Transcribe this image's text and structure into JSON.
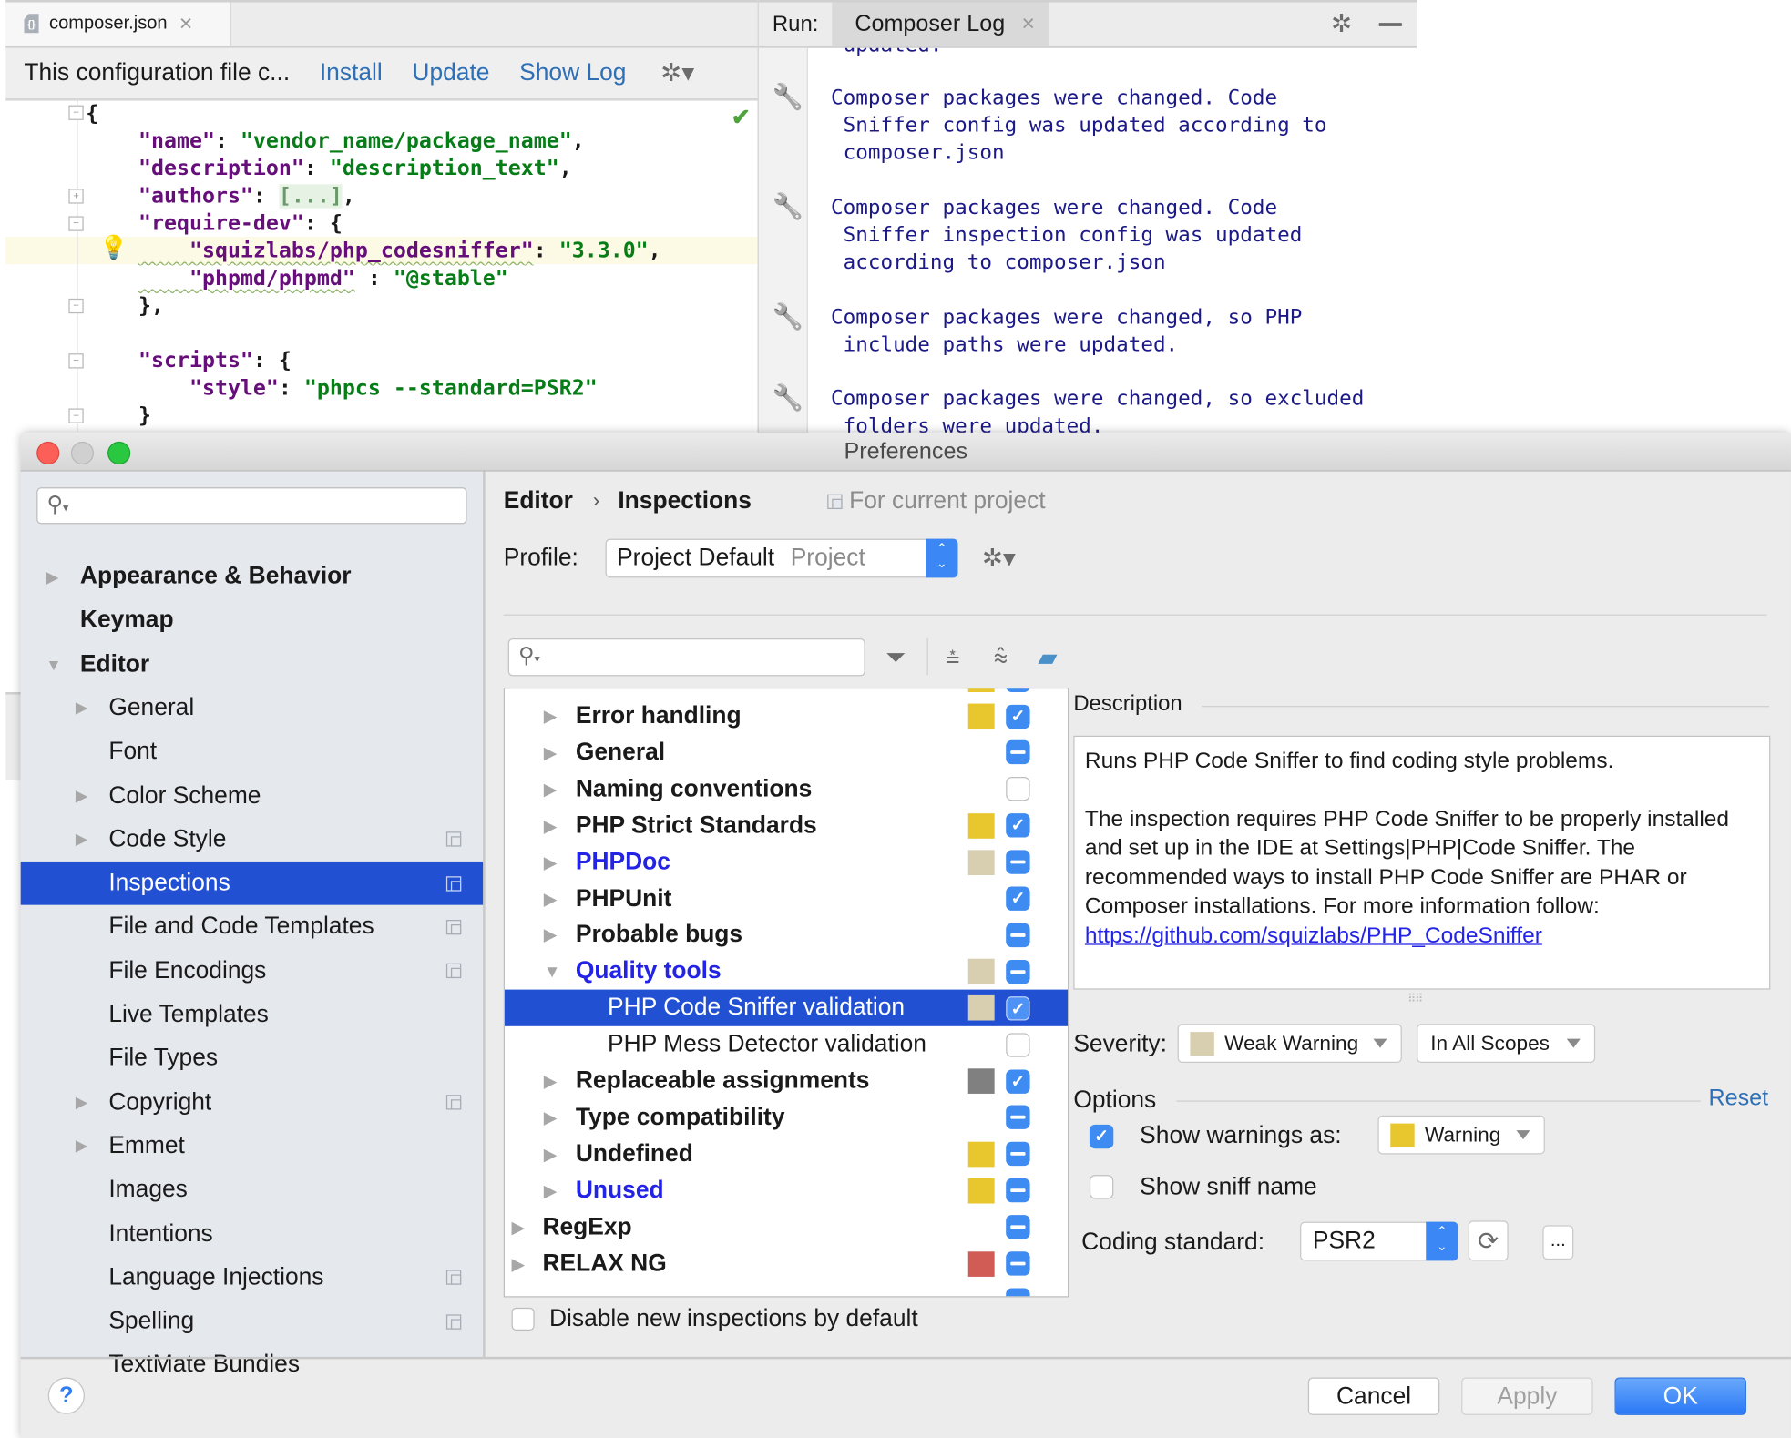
{
  "editor": {
    "tab": {
      "label": "composer.json",
      "icon": "json-file-icon"
    },
    "notification": {
      "text": "This configuration file c...",
      "links": [
        "Install",
        "Update",
        "Show Log"
      ]
    },
    "code": [
      {
        "parts": [
          {
            "t": "p",
            "v": "{"
          }
        ]
      },
      {
        "parts": [
          {
            "t": "k",
            "v": "\"name\""
          },
          {
            "t": "p",
            "v": ": "
          },
          {
            "t": "s",
            "v": "\"vendor_name/package_name\""
          },
          {
            "t": "p",
            "v": ","
          }
        ]
      },
      {
        "parts": [
          {
            "t": "k",
            "v": "\"description\""
          },
          {
            "t": "p",
            "v": ": "
          },
          {
            "t": "s",
            "v": "\"description_text\""
          },
          {
            "t": "p",
            "v": ","
          }
        ]
      },
      {
        "parts": [
          {
            "t": "k",
            "v": "\"authors\""
          },
          {
            "t": "p",
            "v": ": "
          },
          {
            "t": "e",
            "v": "[...]"
          },
          {
            "t": "p",
            "v": ","
          }
        ]
      },
      {
        "parts": [
          {
            "t": "k",
            "v": "\"require-dev\""
          },
          {
            "t": "p",
            "v": ": {"
          }
        ]
      },
      {
        "parts": [
          {
            "t": "k",
            "v": "    \"squizlabs/php_codesniffer\""
          },
          {
            "t": "p",
            "v": ": "
          },
          {
            "t": "s",
            "v": "\"3.3.0\""
          },
          {
            "t": "p",
            "v": ","
          }
        ]
      },
      {
        "parts": [
          {
            "t": "k",
            "v": "    \"phpmd/phpmd\""
          },
          {
            "t": "p",
            "v": " : "
          },
          {
            "t": "s",
            "v": "\"@stable\""
          }
        ]
      },
      {
        "parts": [
          {
            "t": "p",
            "v": "},"
          }
        ]
      },
      {
        "parts": []
      },
      {
        "parts": [
          {
            "t": "k",
            "v": "\"scripts\""
          },
          {
            "t": "p",
            "v": ": {"
          }
        ]
      },
      {
        "parts": [
          {
            "t": "k",
            "v": "    \"style\""
          },
          {
            "t": "p",
            "v": ": "
          },
          {
            "t": "s",
            "v": "\"phpcs --standard=PSR2\""
          }
        ]
      },
      {
        "parts": [
          {
            "t": "p",
            "v": "}"
          }
        ]
      }
    ]
  },
  "run_panel": {
    "label": "Run:",
    "tab": "Composer Log",
    "top_cut_line": " updated.",
    "messages": [
      [
        "Composer packages were changed. Code",
        " Sniffer config was updated according to",
        " composer.json"
      ],
      [
        "Composer packages were changed. Code",
        " Sniffer inspection config was updated",
        " according to composer.json"
      ],
      [
        "Composer packages were changed, so PHP",
        " include paths were updated."
      ],
      [
        "Composer packages were changed, so excluded",
        " folders were updated."
      ]
    ]
  },
  "preferences": {
    "title": "Preferences",
    "search_placeholder": "",
    "sidebar": [
      {
        "label": "Appearance & Behavior",
        "level": 0,
        "bold": true,
        "arrow": "right",
        "project": false
      },
      {
        "label": "Keymap",
        "level": 0,
        "bold": true,
        "arrow": null,
        "project": false
      },
      {
        "label": "Editor",
        "level": 0,
        "bold": true,
        "arrow": "down",
        "project": false
      },
      {
        "label": "General",
        "level": 1,
        "bold": false,
        "arrow": "right",
        "project": false
      },
      {
        "label": "Font",
        "level": 1,
        "bold": false,
        "arrow": null,
        "project": false
      },
      {
        "label": "Color Scheme",
        "level": 1,
        "bold": false,
        "arrow": "right",
        "project": false
      },
      {
        "label": "Code Style",
        "level": 1,
        "bold": false,
        "arrow": "right",
        "project": true
      },
      {
        "label": "Inspections",
        "level": 1,
        "bold": false,
        "arrow": null,
        "project": true,
        "selected": true
      },
      {
        "label": "File and Code Templates",
        "level": 1,
        "bold": false,
        "arrow": null,
        "project": true
      },
      {
        "label": "File Encodings",
        "level": 1,
        "bold": false,
        "arrow": null,
        "project": true
      },
      {
        "label": "Live Templates",
        "level": 1,
        "bold": false,
        "arrow": null,
        "project": false
      },
      {
        "label": "File Types",
        "level": 1,
        "bold": false,
        "arrow": null,
        "project": false
      },
      {
        "label": "Copyright",
        "level": 1,
        "bold": false,
        "arrow": "right",
        "project": true
      },
      {
        "label": "Emmet",
        "level": 1,
        "bold": false,
        "arrow": "right",
        "project": false
      },
      {
        "label": "Images",
        "level": 1,
        "bold": false,
        "arrow": null,
        "project": false
      },
      {
        "label": "Intentions",
        "level": 1,
        "bold": false,
        "arrow": null,
        "project": false
      },
      {
        "label": "Language Injections",
        "level": 1,
        "bold": false,
        "arrow": null,
        "project": true
      },
      {
        "label": "Spelling",
        "level": 1,
        "bold": false,
        "arrow": null,
        "project": true
      },
      {
        "label": "TextMate Bundles",
        "level": 1,
        "bold": false,
        "arrow": null,
        "project": false
      }
    ],
    "breadcrumb": {
      "parent": "Editor",
      "separator": "›",
      "current": "Inspections",
      "scope": "For current project"
    },
    "profile": {
      "label": "Profile:",
      "value": "Project Default",
      "scope": "Project"
    },
    "tree_search_placeholder": "",
    "toolbar_icons": [
      "filter-icon",
      "expand-all-icon",
      "collapse-all-icon",
      "reset-eraser-icon"
    ],
    "colors": {
      "warning": "#e8c62e",
      "weak_warning": "#d8cfb0",
      "server_problem": "#808080",
      "error": "#d15c55",
      "accent": "#2150d3",
      "checkbox": "#3e8bf1"
    },
    "inspections": [
      {
        "label": "Error handling",
        "level": 1,
        "bold": true,
        "blue": false,
        "arrow": "right",
        "severity": "warning",
        "state": "on"
      },
      {
        "label": "General",
        "level": 1,
        "bold": true,
        "blue": false,
        "arrow": "right",
        "severity": null,
        "state": "mixed"
      },
      {
        "label": "Naming conventions",
        "level": 1,
        "bold": true,
        "blue": false,
        "arrow": "right",
        "severity": null,
        "state": "off"
      },
      {
        "label": "PHP Strict Standards",
        "level": 1,
        "bold": true,
        "blue": false,
        "arrow": "right",
        "severity": "warning",
        "state": "on"
      },
      {
        "label": "PHPDoc",
        "level": 1,
        "bold": true,
        "blue": true,
        "arrow": "right",
        "severity": "weak_warning",
        "state": "mixed"
      },
      {
        "label": "PHPUnit",
        "level": 1,
        "bold": true,
        "blue": false,
        "arrow": "right",
        "severity": null,
        "state": "on"
      },
      {
        "label": "Probable bugs",
        "level": 1,
        "bold": true,
        "blue": false,
        "arrow": "right",
        "severity": null,
        "state": "mixed"
      },
      {
        "label": "Quality tools",
        "level": 1,
        "bold": true,
        "blue": true,
        "arrow": "down",
        "severity": "weak_warning",
        "state": "mixed"
      },
      {
        "label": "PHP Code Sniffer validation",
        "level": 2,
        "bold": false,
        "blue": false,
        "arrow": null,
        "severity": "weak_warning",
        "state": "on",
        "selected": true
      },
      {
        "label": "PHP Mess Detector validation",
        "level": 2,
        "bold": false,
        "blue": false,
        "arrow": null,
        "severity": null,
        "state": "off"
      },
      {
        "label": "Replaceable assignments",
        "level": 1,
        "bold": true,
        "blue": false,
        "arrow": "right",
        "severity": "server_problem",
        "state": "on"
      },
      {
        "label": "Type compatibility",
        "level": 1,
        "bold": true,
        "blue": false,
        "arrow": "right",
        "severity": null,
        "state": "mixed"
      },
      {
        "label": "Undefined",
        "level": 1,
        "bold": true,
        "blue": false,
        "arrow": "right",
        "severity": "warning",
        "state": "mixed"
      },
      {
        "label": "Unused",
        "level": 1,
        "bold": true,
        "blue": true,
        "arrow": "right",
        "severity": "warning",
        "state": "mixed"
      },
      {
        "label": "RegExp",
        "level": 0,
        "bold": true,
        "blue": false,
        "arrow": "right",
        "severity": null,
        "state": "mixed"
      },
      {
        "label": "RELAX NG",
        "level": 0,
        "bold": true,
        "blue": false,
        "arrow": "right",
        "severity": "error",
        "state": "mixed"
      }
    ],
    "disable_new": {
      "label": "Disable new inspections by default",
      "checked": false
    },
    "description": {
      "title": "Description",
      "line1": "Runs PHP Code Sniffer to find coding style problems.",
      "body": "The inspection requires PHP Code Sniffer to be properly installed and set up in the IDE at Settings|PHP|Code Sniffer. The recommended ways to install PHP Code Sniffer are PHAR or Composer installations. For more information follow: ",
      "link": "https://github.com/squizlabs/PHP_CodeSniffer"
    },
    "severity": {
      "label": "Severity:",
      "value": "Weak Warning",
      "scope": "In All Scopes"
    },
    "options": {
      "title": "Options",
      "reset": "Reset",
      "show_warnings": {
        "label": "Show warnings as:",
        "checked": true,
        "value": "Warning"
      },
      "show_sniff_name": {
        "label": "Show sniff name",
        "checked": false
      },
      "coding_standard": {
        "label": "Coding standard:",
        "value": "PSR2",
        "more": "..."
      }
    },
    "buttons": {
      "help": "?",
      "cancel": "Cancel",
      "apply": "Apply",
      "ok": "OK"
    }
  }
}
